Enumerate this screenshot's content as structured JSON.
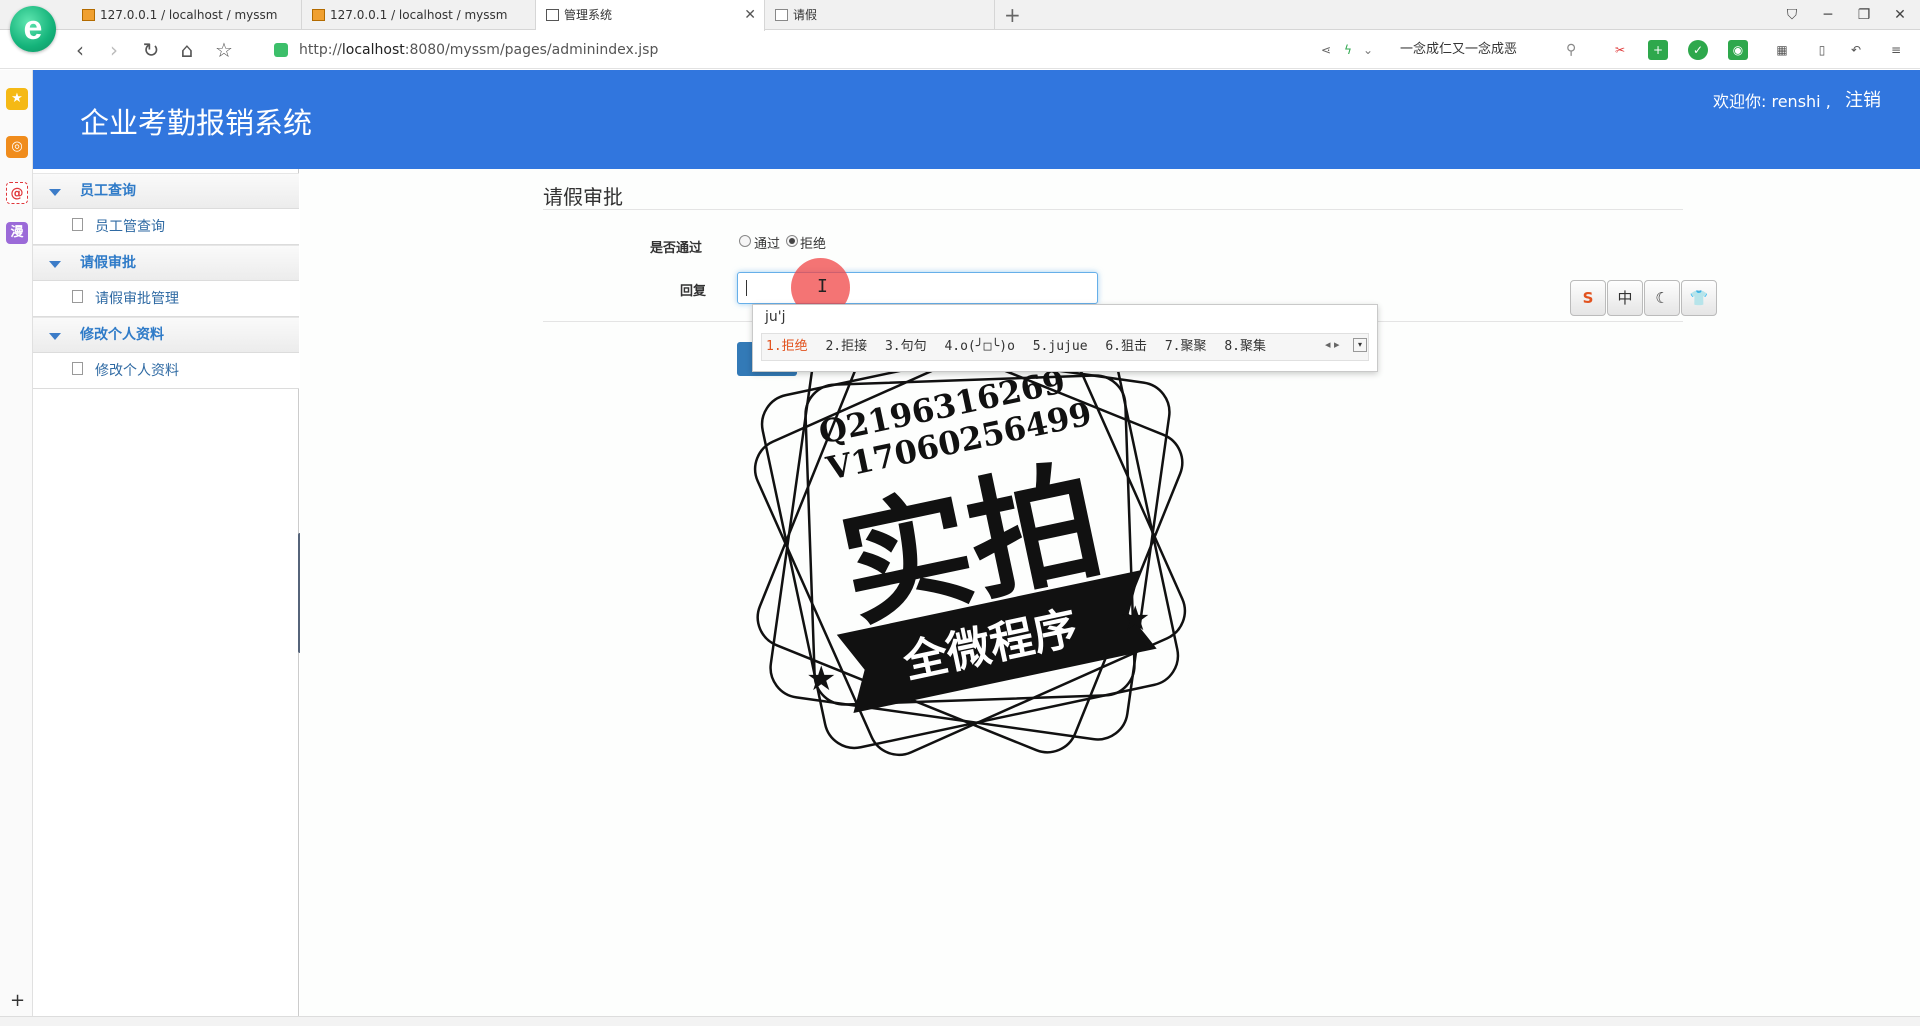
{
  "browser": {
    "tabs": [
      {
        "label": "127.0.0.1 / localhost / myssm",
        "icon": "phpmyadmin-icon"
      },
      {
        "label": "127.0.0.1 / localhost / myssm",
        "icon": "phpmyadmin-icon"
      },
      {
        "label": "管理系统",
        "icon": "chart-icon",
        "active": true
      },
      {
        "label": "请假",
        "icon": "page-icon"
      }
    ],
    "url_prefix": "http://",
    "url_host": "localhost",
    "url_rest": ":8080/myssm/pages/adminindex.jsp",
    "search_text": "一念成仁又一念成恶"
  },
  "app": {
    "title": "企业考勤报销系统",
    "welcome": "欢迎你: renshi ,",
    "logout": "注销"
  },
  "sidebar": {
    "groups": [
      {
        "label": "员工查询",
        "items": [
          {
            "label": "员工管查询"
          }
        ]
      },
      {
        "label": "请假审批",
        "items": [
          {
            "label": "请假审批管理"
          }
        ]
      },
      {
        "label": "修改个人资料",
        "items": [
          {
            "label": "修改个人资料"
          }
        ]
      }
    ]
  },
  "form": {
    "title": "请假审批",
    "approve_label": "是否通过",
    "options": [
      "通过",
      "拒绝"
    ],
    "selected": "拒绝",
    "reply_label": "回复",
    "reply_value": ""
  },
  "ime": {
    "composition": "ju'j",
    "candidates": [
      "1.拒绝",
      "2.拒接",
      "3.句句",
      "4.o(╯□╰)o",
      "5.jujue",
      "6.狙击",
      "7.聚聚",
      "8.聚集"
    ],
    "toolbar": [
      "S",
      "中",
      "☾",
      "👕"
    ]
  },
  "watermark": {
    "line1": "Q2196316269",
    "line2": "V17060256499",
    "main": "实拍",
    "banner": "全微程序"
  },
  "colors": {
    "header_bg": "#3176de",
    "menu_text": "#2f7bc8",
    "button_primary": "#337ab7"
  }
}
